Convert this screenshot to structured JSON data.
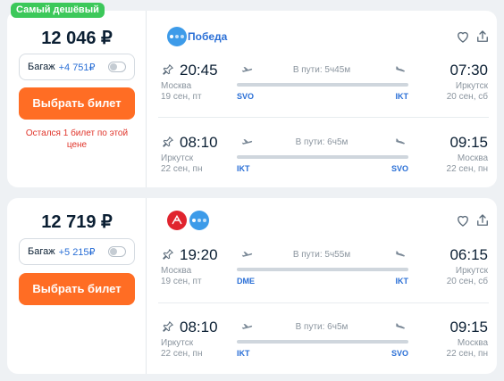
{
  "offers": [
    {
      "badge": "Самый дешёвый",
      "price": "12 046 ₽",
      "baggage_label": "Багаж",
      "baggage_price": "+4 751₽",
      "buy_label": "Выбрать билет",
      "warning": "Остался 1 билет по этой цене",
      "airline": "Победа",
      "segments": [
        {
          "dep_time": "20:45",
          "dep_city": "Москва",
          "dep_date": "19 сен, пт",
          "dep_iata": "SVO",
          "duration": "В пути: 5ч45м",
          "arr_time": "07:30",
          "arr_city": "Иркутск",
          "arr_date": "20 сен, сб",
          "arr_iata": "IKT"
        },
        {
          "dep_time": "08:10",
          "dep_city": "Иркутск",
          "dep_date": "22 сен, пн",
          "dep_iata": "IKT",
          "duration": "В пути: 6ч5м",
          "arr_time": "09:15",
          "arr_city": "Москва",
          "arr_date": "22 сен, пн",
          "arr_iata": "SVO"
        }
      ]
    },
    {
      "price": "12 719 ₽",
      "baggage_label": "Багаж",
      "baggage_price": "+5 215₽",
      "buy_label": "Выбрать билет",
      "segments": [
        {
          "dep_time": "19:20",
          "dep_city": "Москва",
          "dep_date": "19 сен, пт",
          "dep_iata": "DME",
          "duration": "В пути: 5ч55м",
          "arr_time": "06:15",
          "arr_city": "Иркутск",
          "arr_date": "20 сен, сб",
          "arr_iata": "IKT"
        },
        {
          "dep_time": "08:10",
          "dep_city": "Иркутск",
          "dep_date": "22 сен, пн",
          "dep_iata": "IKT",
          "duration": "В пути: 6ч5м",
          "arr_time": "09:15",
          "arr_city": "Москва",
          "arr_date": "22 сен, пн",
          "arr_iata": "SVO"
        }
      ]
    }
  ],
  "colors": {
    "accent": "#ff6d24",
    "link": "#2a6fd6",
    "badge": "#3cc85a",
    "warning": "#e0342a",
    "background": "#eef1f4"
  },
  "icons": [
    "heart-icon",
    "share-icon",
    "pin-icon",
    "takeoff-icon",
    "landing-icon",
    "pobeda-logo",
    "red-airline-logo"
  ]
}
